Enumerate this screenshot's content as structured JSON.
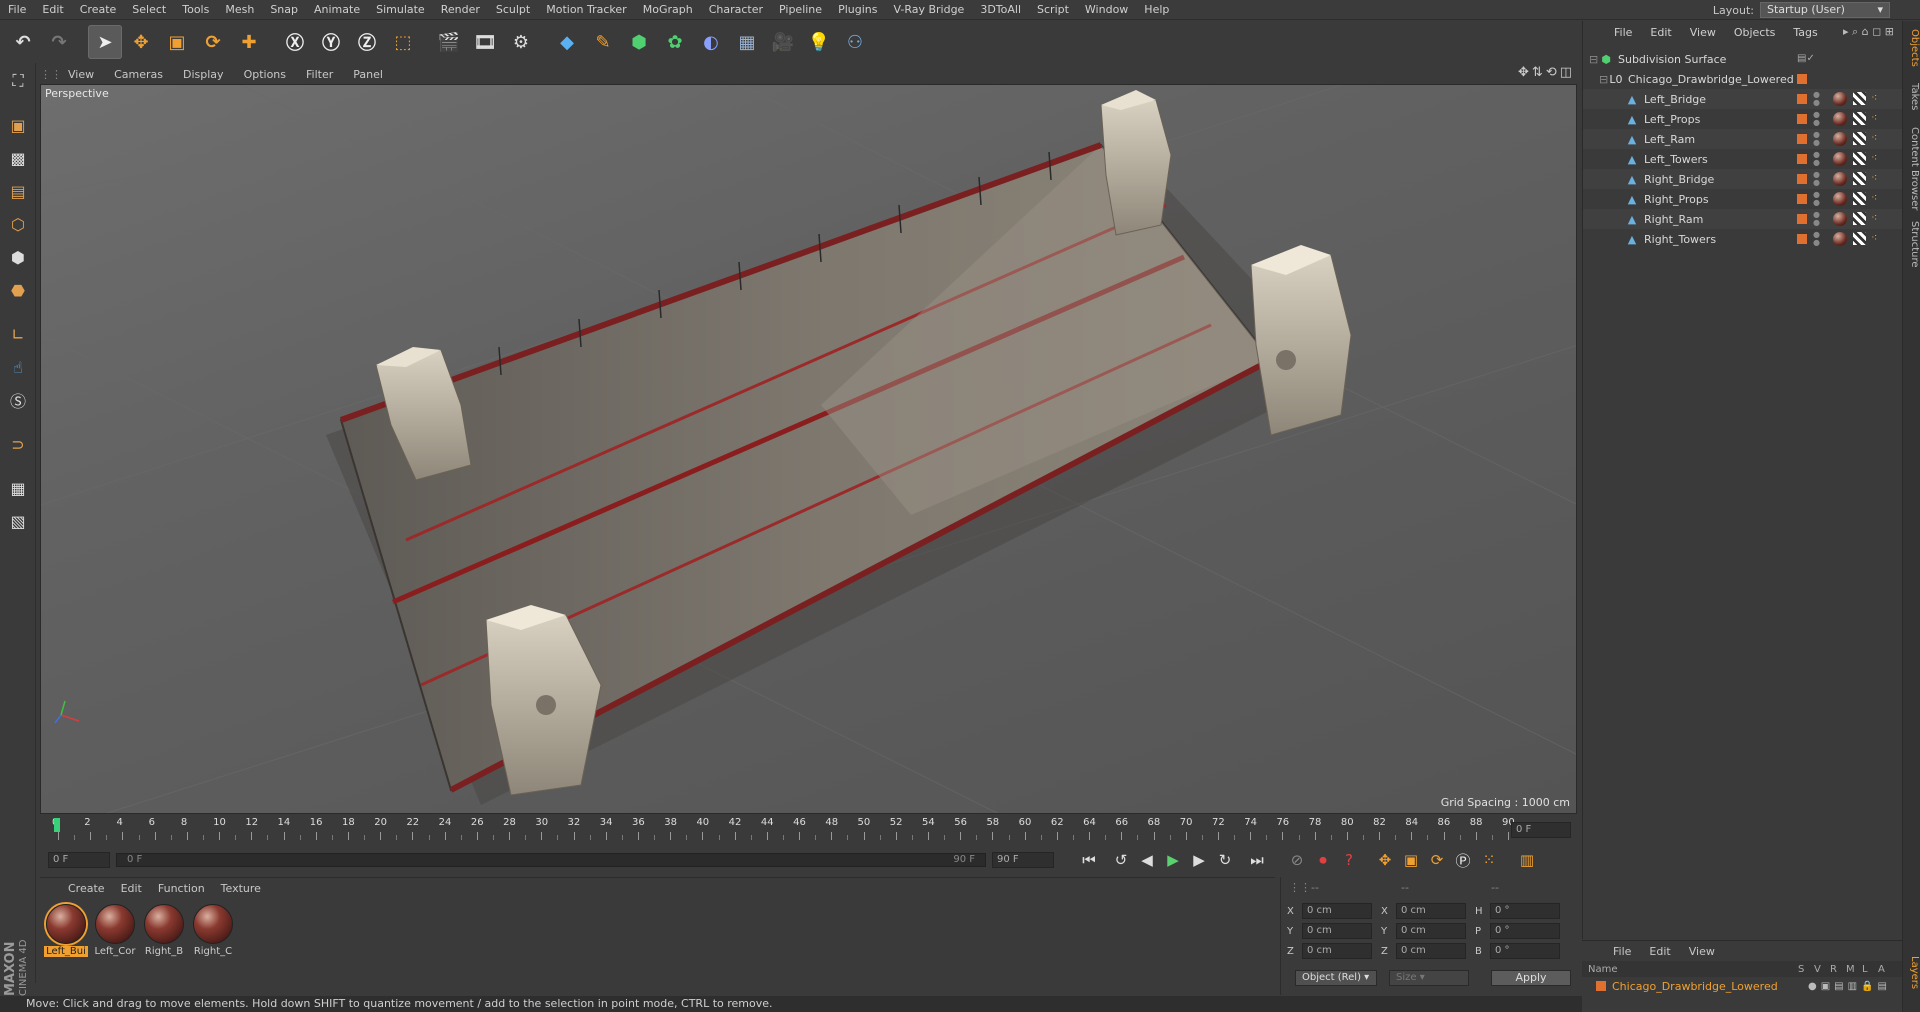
{
  "menu": [
    "File",
    "Edit",
    "Create",
    "Select",
    "Tools",
    "Mesh",
    "Snap",
    "Animate",
    "Simulate",
    "Render",
    "Sculpt",
    "Motion Tracker",
    "MoGraph",
    "Character",
    "Pipeline",
    "Plugins",
    "V-Ray Bridge",
    "3DToAll",
    "Script",
    "Window",
    "Help"
  ],
  "layout": {
    "label": "Layout:",
    "value": "Startup (User)"
  },
  "viewport_menu": [
    "View",
    "Cameras",
    "Display",
    "Options",
    "Filter",
    "Panel"
  ],
  "viewport": {
    "camera_label": "Perspective",
    "grid_spacing": "Grid Spacing : 1000 cm"
  },
  "timeline": {
    "ticks": [
      "0",
      "2",
      "4",
      "6",
      "8",
      "10",
      "12",
      "14",
      "16",
      "18",
      "20",
      "22",
      "24",
      "26",
      "28",
      "30",
      "32",
      "34",
      "36",
      "38",
      "40",
      "42",
      "44",
      "46",
      "48",
      "50",
      "52",
      "54",
      "56",
      "58",
      "60",
      "62",
      "64",
      "66",
      "68",
      "70",
      "72",
      "74",
      "76",
      "78",
      "80",
      "82",
      "84",
      "86",
      "88",
      "90"
    ],
    "current_frame": "0 F",
    "start_frame": "0 F",
    "range_start": "0 F",
    "range_end": "90 F",
    "end_frame": "90 F"
  },
  "material_menu": [
    "Create",
    "Edit",
    "Function",
    "Texture"
  ],
  "materials": [
    {
      "name": "Left_Bui",
      "selected": true
    },
    {
      "name": "Left_Cor",
      "selected": false
    },
    {
      "name": "Right_B",
      "selected": false
    },
    {
      "name": "Right_C",
      "selected": false
    }
  ],
  "coords": {
    "header1": "--",
    "header2": "--",
    "header3": "--",
    "rows": [
      {
        "a": "X",
        "av": "0 cm",
        "b": "X",
        "bv": "0 cm",
        "c": "H",
        "cv": "0 °"
      },
      {
        "a": "Y",
        "av": "0 cm",
        "b": "Y",
        "bv": "0 cm",
        "c": "P",
        "cv": "0 °"
      },
      {
        "a": "Z",
        "av": "0 cm",
        "b": "Z",
        "bv": "0 cm",
        "c": "B",
        "cv": "0 °"
      }
    ],
    "mode": "Object (Rel)",
    "size_mode": "Size",
    "apply": "Apply"
  },
  "object_menu": [
    "File",
    "Edit",
    "View",
    "Objects",
    "Tags"
  ],
  "objects": {
    "root": "Subdivision Surface",
    "group": "Chicago_Drawbridge_Lowered",
    "children": [
      "Left_Bridge",
      "Left_Props",
      "Left_Ram",
      "Left_Towers",
      "Right_Bridge",
      "Right_Props",
      "Right_Ram",
      "Right_Towers"
    ]
  },
  "layers_menu": [
    "File",
    "Edit",
    "View"
  ],
  "layers": {
    "columns": [
      "Name",
      "S",
      "V",
      "R",
      "M",
      "L",
      "A"
    ],
    "row": "Chicago_Drawbridge_Lowered"
  },
  "side_tabs": [
    "Objects",
    "Takes",
    "Content Browser",
    "Structure",
    "Layers"
  ],
  "status": "Move: Click and drag to move elements. Hold down SHIFT to quantize movement / add to the selection in point mode, CTRL to remove.",
  "logo": {
    "line1": "MAXON",
    "line2": "CINEMA 4D"
  },
  "colors": {
    "accent": "#f0a030",
    "object_icon": "#6ab0e0",
    "layer_flag": "#e07030"
  }
}
